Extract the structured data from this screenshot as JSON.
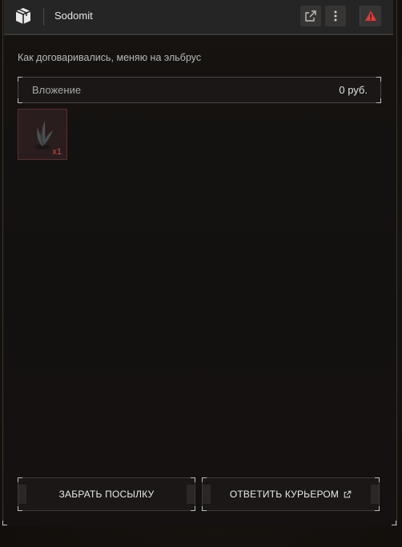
{
  "header": {
    "title": "Sodomit",
    "icons": [
      "package-icon",
      "external-link-icon",
      "more-vertical-icon",
      "warning-icon"
    ],
    "warning_color": "#e53935"
  },
  "message": {
    "text": "Как договаривались, меняю на эльбрус"
  },
  "attachment": {
    "label": "Вложение",
    "price": "0 руб."
  },
  "items": [
    {
      "icon": "plant-item-icon",
      "quantity": "x1",
      "accent_color": "#e04444"
    }
  ],
  "actions": {
    "take_label": "ЗАБРАТЬ ПОСЫЛКУ",
    "reply_label": "ОТВЕТИТЬ КУРЬЕРОМ"
  }
}
